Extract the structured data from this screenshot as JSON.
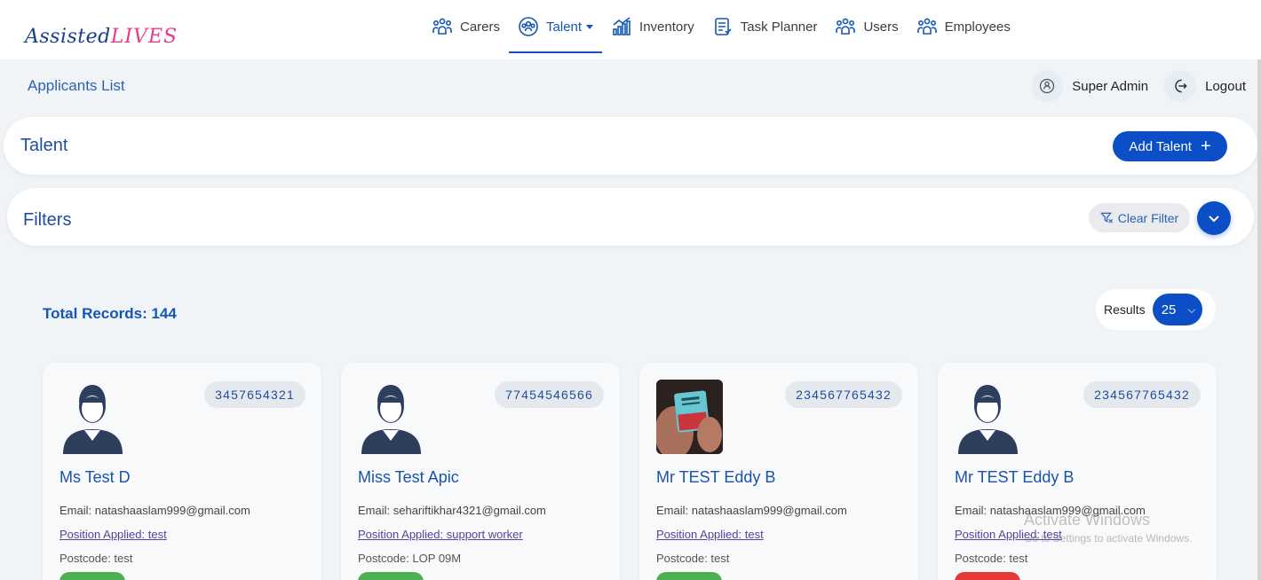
{
  "logo": {
    "part1": "Assisted",
    "part2": "LIVES"
  },
  "nav": [
    {
      "label": "Carers",
      "icon": "people-group-icon",
      "active": false
    },
    {
      "label": "Talent",
      "icon": "talent-icon",
      "active": true,
      "dropdown": true
    },
    {
      "label": "Inventory",
      "icon": "bar-chart-icon",
      "active": false
    },
    {
      "label": "Task Planner",
      "icon": "task-list-icon",
      "active": false
    },
    {
      "label": "Users",
      "icon": "people-group-icon",
      "active": false
    },
    {
      "label": "Employees",
      "icon": "people-group-icon",
      "active": false
    }
  ],
  "page": {
    "title": "Applicants List"
  },
  "user": {
    "role": "Super Admin",
    "logout_label": "Logout"
  },
  "talent_panel": {
    "title": "Talent",
    "add_label": "Add Talent",
    "add_symbol": "+"
  },
  "filters": {
    "title": "Filters",
    "clear_label": "Clear Filter"
  },
  "records": {
    "total_label": "Total Records: 144"
  },
  "results": {
    "label": "Results",
    "value": "25"
  },
  "cards": [
    {
      "phone": "3457654321",
      "name": "Ms Test D",
      "email": "Email: natashaaslam999@gmail.com",
      "position": "Position Applied: test",
      "postcode": "Postcode: test",
      "status_color": "#4caf50",
      "photo": false
    },
    {
      "phone": "77454546566",
      "name": "Miss Test Apic",
      "email": "Email: sehariftikhar4321@gmail.com",
      "position": "Position Applied: support worker",
      "postcode": "Postcode: LOP 09M",
      "status_color": "#4caf50",
      "photo": false
    },
    {
      "phone": "234567765432",
      "name": "Mr TEST Eddy B",
      "email": "Email: natashaaslam999@gmail.com",
      "position": "Position Applied: test",
      "postcode": "Postcode: test",
      "status_color": "#4caf50",
      "photo": true
    },
    {
      "phone": "234567765432",
      "name": "Mr TEST Eddy B",
      "email": "Email: natashaaslam999@gmail.com",
      "position": "Position Applied: test",
      "postcode": "Postcode: test",
      "status_color": "#e53935",
      "photo": false
    }
  ],
  "watermark": {
    "line1": "Activate Windows",
    "line2": "Go to Settings to activate Windows."
  },
  "colors": {
    "primary": "#0b4ec6",
    "heading": "#1f4e9c",
    "background": "#f1f4f7"
  }
}
